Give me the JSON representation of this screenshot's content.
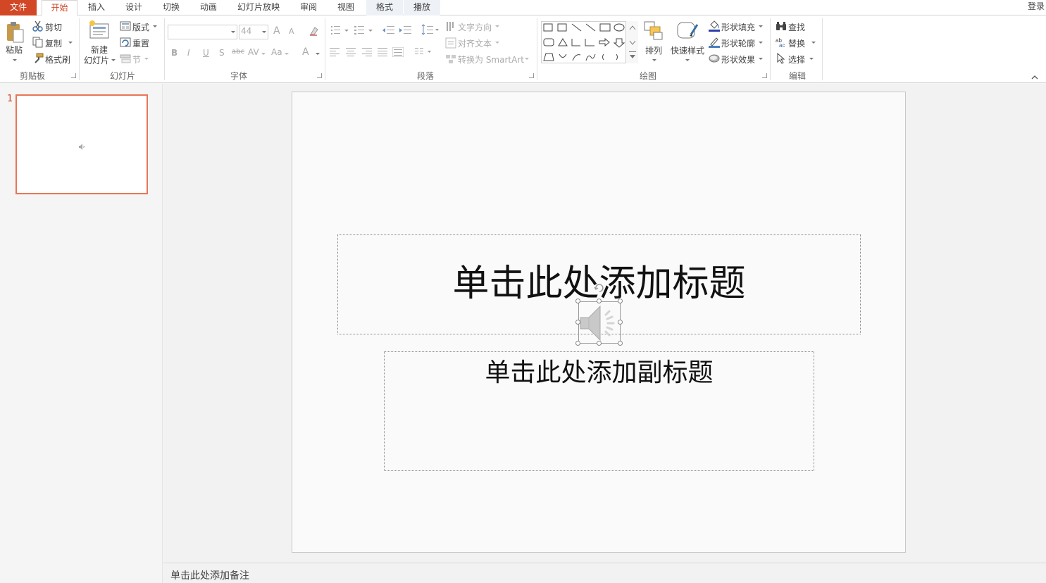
{
  "tabs": {
    "file": "文件",
    "home": "开始",
    "insert": "插入",
    "design": "设计",
    "transitions": "切换",
    "animations": "动画",
    "slideshow": "幻灯片放映",
    "review": "审阅",
    "view": "视图",
    "format": "格式",
    "playback": "播放"
  },
  "login": "登录",
  "ribbon": {
    "clipboard": {
      "paste": "粘贴",
      "cut": "剪切",
      "copy": "复制",
      "format_painter": "格式刷",
      "label": "剪贴板"
    },
    "slides": {
      "new_slide_1": "新建",
      "new_slide_2": "幻灯片",
      "layout": "版式",
      "reset": "重置",
      "section": "节",
      "label": "幻灯片"
    },
    "font": {
      "font_size": "44",
      "bold": "B",
      "italic": "I",
      "underline": "U",
      "shadow": "S",
      "strike": "abc",
      "spacing": "AV",
      "case": "Aa",
      "grow": "A",
      "shrink": "A",
      "color": "A",
      "label": "字体"
    },
    "paragraph": {
      "text_direction": "文字方向",
      "align_text": "对齐文本",
      "smartart": "转换为 SmartArt",
      "label": "段落"
    },
    "drawing": {
      "arrange": "排列",
      "quick_styles": "快速样式",
      "shape_fill": "形状填充",
      "shape_outline": "形状轮廓",
      "shape_effects": "形状效果",
      "label": "绘图"
    },
    "editing": {
      "find": "查找",
      "replace": "替换",
      "select": "选择",
      "label": "编辑"
    }
  },
  "thumbnails": {
    "slide_number": "1"
  },
  "slide": {
    "title_placeholder": "单击此处添加标题",
    "subtitle_placeholder": "单击此处添加副标题"
  },
  "notes": {
    "placeholder": "单击此处添加备注"
  },
  "colors": {
    "accent": "#d24726",
    "thumb_border": "#e87656"
  }
}
